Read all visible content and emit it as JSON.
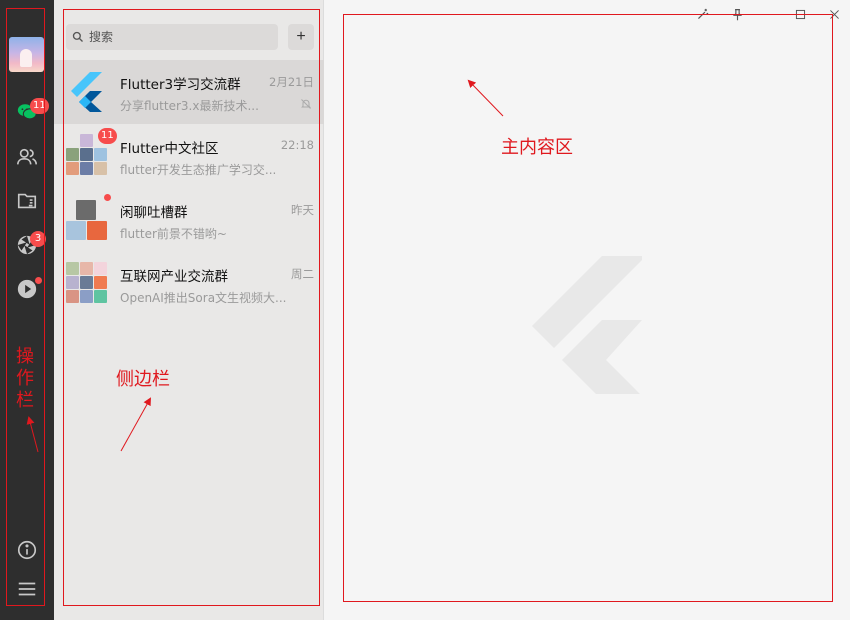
{
  "action_bar": {
    "icons": [
      {
        "name": "chat-icon",
        "badge": "11"
      },
      {
        "name": "contacts-icon",
        "badge": ""
      },
      {
        "name": "folder-icon",
        "badge": ""
      },
      {
        "name": "moments-icon",
        "badge": "3"
      },
      {
        "name": "video-icon",
        "badge": "dot"
      }
    ],
    "bottom_icons": [
      "info-icon",
      "menu-icon"
    ]
  },
  "sidebar": {
    "search_placeholder": "搜索",
    "add_label": "+",
    "chats": [
      {
        "title": "Flutter3学习交流群",
        "preview": "分享flutter3.x最新技术...",
        "time": "2月21日",
        "muted": true,
        "badge": ""
      },
      {
        "title": "Flutter中文社区",
        "preview": "flutter开发生态推广学习交...",
        "time": "22:18",
        "muted": false,
        "badge": "11"
      },
      {
        "title": "闲聊吐槽群",
        "preview": "flutter前景不错哟~",
        "time": "昨天",
        "muted": false,
        "badge": "dot"
      },
      {
        "title": "互联网产业交流群",
        "preview": "OpenAI推出Sora文生视频大...",
        "time": "周二",
        "muted": false,
        "badge": ""
      }
    ]
  },
  "window_controls": [
    "magic-wand-icon",
    "pin-icon",
    "maximize-icon",
    "close-icon"
  ],
  "annotations": {
    "action_bar_label": "操作栏",
    "sidebar_label": "侧边栏",
    "main_label": "主内容区"
  },
  "colors": {
    "action_bar_bg": "#2e2e2e",
    "sidebar_bg": "#e9e8e7",
    "main_bg": "#f5f5f5",
    "badge": "#f74c4c",
    "annotation": "#e0181e",
    "active_icon": "#07c160"
  }
}
